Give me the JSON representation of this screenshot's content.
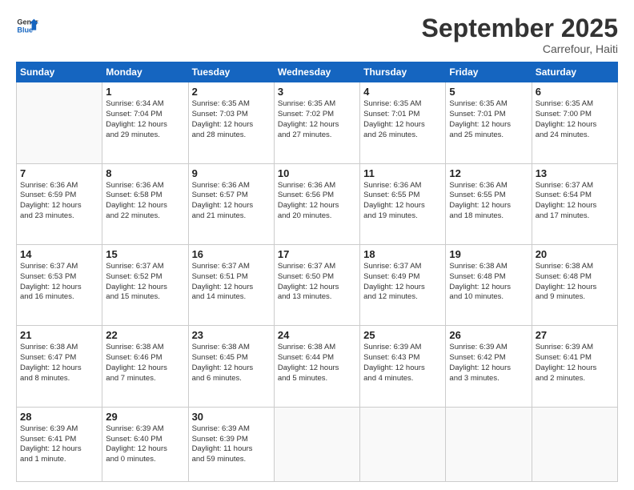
{
  "logo": {
    "line1": "General",
    "line2": "Blue"
  },
  "title": "September 2025",
  "subtitle": "Carrefour, Haiti",
  "header_days": [
    "Sunday",
    "Monday",
    "Tuesday",
    "Wednesday",
    "Thursday",
    "Friday",
    "Saturday"
  ],
  "weeks": [
    [
      {
        "day": "",
        "info": ""
      },
      {
        "day": "1",
        "info": "Sunrise: 6:34 AM\nSunset: 7:04 PM\nDaylight: 12 hours\nand 29 minutes."
      },
      {
        "day": "2",
        "info": "Sunrise: 6:35 AM\nSunset: 7:03 PM\nDaylight: 12 hours\nand 28 minutes."
      },
      {
        "day": "3",
        "info": "Sunrise: 6:35 AM\nSunset: 7:02 PM\nDaylight: 12 hours\nand 27 minutes."
      },
      {
        "day": "4",
        "info": "Sunrise: 6:35 AM\nSunset: 7:01 PM\nDaylight: 12 hours\nand 26 minutes."
      },
      {
        "day": "5",
        "info": "Sunrise: 6:35 AM\nSunset: 7:01 PM\nDaylight: 12 hours\nand 25 minutes."
      },
      {
        "day": "6",
        "info": "Sunrise: 6:35 AM\nSunset: 7:00 PM\nDaylight: 12 hours\nand 24 minutes."
      }
    ],
    [
      {
        "day": "7",
        "info": "Sunrise: 6:36 AM\nSunset: 6:59 PM\nDaylight: 12 hours\nand 23 minutes."
      },
      {
        "day": "8",
        "info": "Sunrise: 6:36 AM\nSunset: 6:58 PM\nDaylight: 12 hours\nand 22 minutes."
      },
      {
        "day": "9",
        "info": "Sunrise: 6:36 AM\nSunset: 6:57 PM\nDaylight: 12 hours\nand 21 minutes."
      },
      {
        "day": "10",
        "info": "Sunrise: 6:36 AM\nSunset: 6:56 PM\nDaylight: 12 hours\nand 20 minutes."
      },
      {
        "day": "11",
        "info": "Sunrise: 6:36 AM\nSunset: 6:55 PM\nDaylight: 12 hours\nand 19 minutes."
      },
      {
        "day": "12",
        "info": "Sunrise: 6:36 AM\nSunset: 6:55 PM\nDaylight: 12 hours\nand 18 minutes."
      },
      {
        "day": "13",
        "info": "Sunrise: 6:37 AM\nSunset: 6:54 PM\nDaylight: 12 hours\nand 17 minutes."
      }
    ],
    [
      {
        "day": "14",
        "info": "Sunrise: 6:37 AM\nSunset: 6:53 PM\nDaylight: 12 hours\nand 16 minutes."
      },
      {
        "day": "15",
        "info": "Sunrise: 6:37 AM\nSunset: 6:52 PM\nDaylight: 12 hours\nand 15 minutes."
      },
      {
        "day": "16",
        "info": "Sunrise: 6:37 AM\nSunset: 6:51 PM\nDaylight: 12 hours\nand 14 minutes."
      },
      {
        "day": "17",
        "info": "Sunrise: 6:37 AM\nSunset: 6:50 PM\nDaylight: 12 hours\nand 13 minutes."
      },
      {
        "day": "18",
        "info": "Sunrise: 6:37 AM\nSunset: 6:49 PM\nDaylight: 12 hours\nand 12 minutes."
      },
      {
        "day": "19",
        "info": "Sunrise: 6:38 AM\nSunset: 6:48 PM\nDaylight: 12 hours\nand 10 minutes."
      },
      {
        "day": "20",
        "info": "Sunrise: 6:38 AM\nSunset: 6:48 PM\nDaylight: 12 hours\nand 9 minutes."
      }
    ],
    [
      {
        "day": "21",
        "info": "Sunrise: 6:38 AM\nSunset: 6:47 PM\nDaylight: 12 hours\nand 8 minutes."
      },
      {
        "day": "22",
        "info": "Sunrise: 6:38 AM\nSunset: 6:46 PM\nDaylight: 12 hours\nand 7 minutes."
      },
      {
        "day": "23",
        "info": "Sunrise: 6:38 AM\nSunset: 6:45 PM\nDaylight: 12 hours\nand 6 minutes."
      },
      {
        "day": "24",
        "info": "Sunrise: 6:38 AM\nSunset: 6:44 PM\nDaylight: 12 hours\nand 5 minutes."
      },
      {
        "day": "25",
        "info": "Sunrise: 6:39 AM\nSunset: 6:43 PM\nDaylight: 12 hours\nand 4 minutes."
      },
      {
        "day": "26",
        "info": "Sunrise: 6:39 AM\nSunset: 6:42 PM\nDaylight: 12 hours\nand 3 minutes."
      },
      {
        "day": "27",
        "info": "Sunrise: 6:39 AM\nSunset: 6:41 PM\nDaylight: 12 hours\nand 2 minutes."
      }
    ],
    [
      {
        "day": "28",
        "info": "Sunrise: 6:39 AM\nSunset: 6:41 PM\nDaylight: 12 hours\nand 1 minute."
      },
      {
        "day": "29",
        "info": "Sunrise: 6:39 AM\nSunset: 6:40 PM\nDaylight: 12 hours\nand 0 minutes."
      },
      {
        "day": "30",
        "info": "Sunrise: 6:39 AM\nSunset: 6:39 PM\nDaylight: 11 hours\nand 59 minutes."
      },
      {
        "day": "",
        "info": ""
      },
      {
        "day": "",
        "info": ""
      },
      {
        "day": "",
        "info": ""
      },
      {
        "day": "",
        "info": ""
      }
    ]
  ]
}
